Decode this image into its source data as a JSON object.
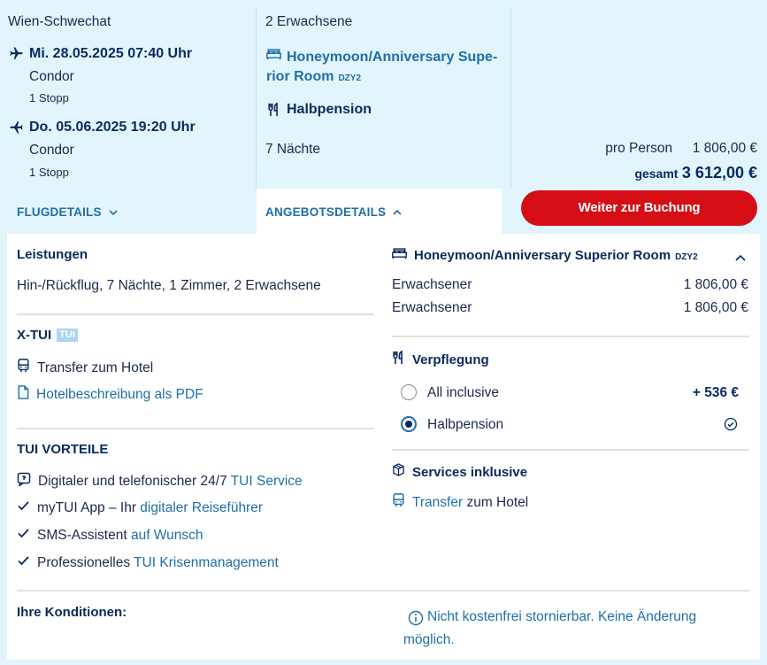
{
  "flight": {
    "origin": "Wien-Schwechat",
    "outbound": {
      "datetime": "Mi. 28.05.2025 07:40 Uhr",
      "airline": "Condor",
      "stops": "1 Stopp"
    },
    "return": {
      "datetime": "Do. 05.06.2025 19:20 Uhr",
      "airline": "Condor",
      "stops": "1 Stopp"
    },
    "details_toggle": "FLUGDETAILS"
  },
  "offer": {
    "travellers": "2 Erwachsene",
    "room_name": "Honeymoon/Anniversary Supe-",
    "room_name_2": "rior Room",
    "room_code": "DZY2",
    "board": "Halbpension",
    "nights": "7 Nächte",
    "details_toggle": "ANGEBOTSDETAILS"
  },
  "price": {
    "per_person_label": "pro Person",
    "per_person_value": "1 806,00 €",
    "total_label": "gesamt",
    "total_value": "3 612,00 €",
    "cta": "Weiter zur Buchung"
  },
  "details": {
    "services_heading": "Leistungen",
    "services_text": "Hin-/Rückflug, 7 Nächte, 1 Zimmer, 2 Erwachsene",
    "xtui_heading": "X-TUI",
    "xtui_badge": "TUI",
    "transfer": "Transfer zum Hotel",
    "pdf_link": "Hotelbeschreibung als PDF",
    "advantages_heading": "TUI VORTEILE",
    "advantages": [
      {
        "text": "Digitaler und telefonischer 24/7 ",
        "link": "TUI Service"
      },
      {
        "text": "myTUI App – Ihr ",
        "link": "digitaler Reiseführer"
      },
      {
        "text": "SMS-Assistent ",
        "link": "auf Wunsch"
      },
      {
        "text": "Professionelles ",
        "link": "TUI Krisenmanagement"
      }
    ],
    "room_heading": "Honeymoon/Anniversary Superior Room",
    "room_code": "DZY2",
    "adults": [
      {
        "label": "Erwachsener",
        "price": "1 806,00 €"
      },
      {
        "label": "Erwachsener",
        "price": "1 806,00 €"
      }
    ],
    "board_heading": "Verpflegung",
    "board_options": [
      {
        "label": "All inclusive",
        "extra": "+ 536 €"
      },
      {
        "label": "Halbpension",
        "extra": ""
      }
    ],
    "services_incl_heading": "Services inklusive",
    "services_incl_link": "Transfer",
    "services_incl_rest": " zum Hotel",
    "conditions_heading": "Ihre Konditionen:",
    "conditions_line1": "Nicht kostenfrei stornierbar. Keine Änderung",
    "conditions_line2": "möglich."
  }
}
